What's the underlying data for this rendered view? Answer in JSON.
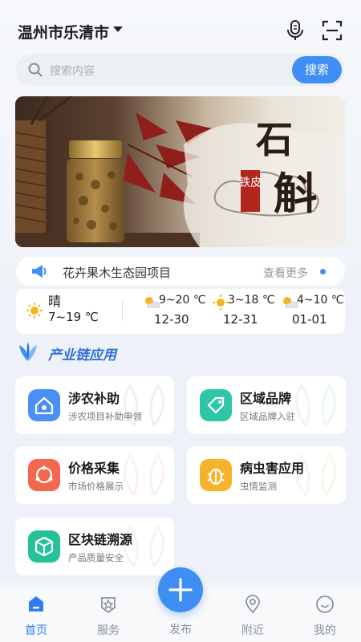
{
  "header": {
    "city": "温州市乐清市"
  },
  "search": {
    "placeholder": "搜索内容",
    "button": "搜索"
  },
  "banner": {
    "title_big": "石斛",
    "title_small": "铁皮"
  },
  "notice": {
    "text": "花卉果木生态园项目",
    "more": "查看更多"
  },
  "weather": {
    "current": {
      "condition": "晴",
      "range": "7~19 ℃",
      "icon": "sun-icon"
    },
    "forecast": [
      {
        "temp": "9~20 ℃",
        "date": "12-30",
        "icon": "partly-cloudy-icon"
      },
      {
        "temp": "3~18 ℃",
        "date": "12-31",
        "icon": "sun-icon"
      },
      {
        "temp": "4~10 ℃",
        "date": "01-01",
        "icon": "partly-cloudy-icon"
      }
    ]
  },
  "section": {
    "title": "产业链应用"
  },
  "apps": [
    {
      "name": "涉农补助",
      "desc": "涉农项目补助申领",
      "color": "#4a8ff5"
    },
    {
      "name": "区域品牌",
      "desc": "区域品牌入驻",
      "color": "#2fc6a8"
    },
    {
      "name": "价格采集",
      "desc": "市场价格展示",
      "color": "#f2674e"
    },
    {
      "name": "病虫害应用",
      "desc": "虫情监测",
      "color": "#f5b32c"
    },
    {
      "name": "区块链溯源",
      "desc": "产品质量安全",
      "color": "#25c29a"
    }
  ],
  "tabs": [
    {
      "label": "首页",
      "icon": "home-icon",
      "active": true
    },
    {
      "label": "服务",
      "icon": "service-icon",
      "active": false
    },
    {
      "label": "发布",
      "icon": "plus-icon",
      "active": false
    },
    {
      "label": "附近",
      "icon": "location-icon",
      "active": false
    },
    {
      "label": "我的",
      "icon": "profile-icon",
      "active": false
    }
  ],
  "colors": {
    "accent": "#3f8ef3",
    "section_title": "#2f6fd8"
  }
}
